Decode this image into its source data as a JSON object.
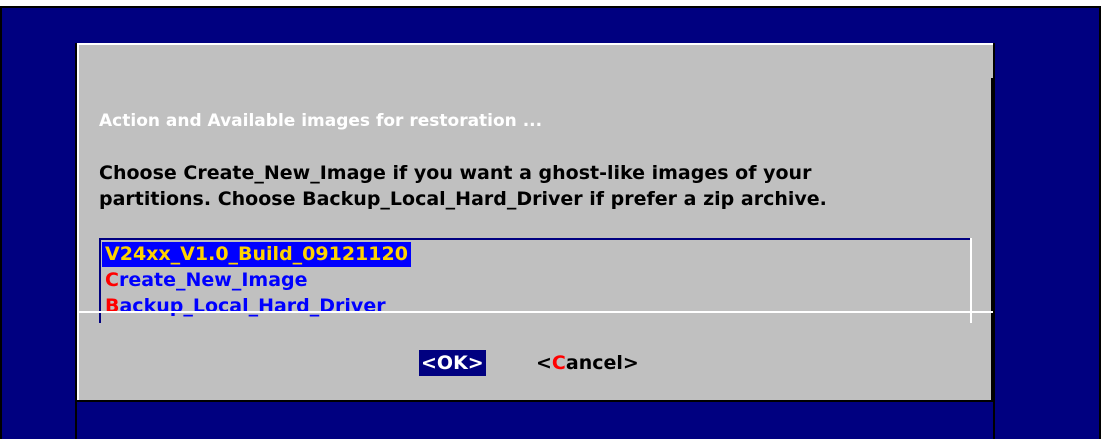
{
  "colors": {
    "screen_bg": "#000080",
    "dialog_bg": "#c0c0c0",
    "title_text": "#ffffff",
    "menu_text": "#0000ff",
    "hotkey": "#ff0000",
    "selected_bg": "#0000ff",
    "selected_text": "#ffd200",
    "ok_bg": "#000080"
  },
  "dialog": {
    "subtitle": "Action and Available images for restoration ...",
    "message_lines": [
      "Choose Create_New_Image if you want a ghost-like images of your",
      "partitions. Choose Backup_Local_Hard_Driver if prefer a zip archive."
    ]
  },
  "menu": {
    "items": [
      {
        "hotkey": "V",
        "rest": "24xx_V1.0_Build_09121120",
        "selected": true
      },
      {
        "hotkey": "C",
        "rest": "reate_New_Image",
        "selected": false
      },
      {
        "hotkey": "B",
        "rest": "ackup_Local_Hard_Driver",
        "selected": false
      }
    ]
  },
  "buttons": {
    "ok": {
      "label": "<OK>",
      "focused": true
    },
    "cancel": {
      "prefix": "<",
      "hotkey": "C",
      "suffix": "ancel>"
    }
  }
}
